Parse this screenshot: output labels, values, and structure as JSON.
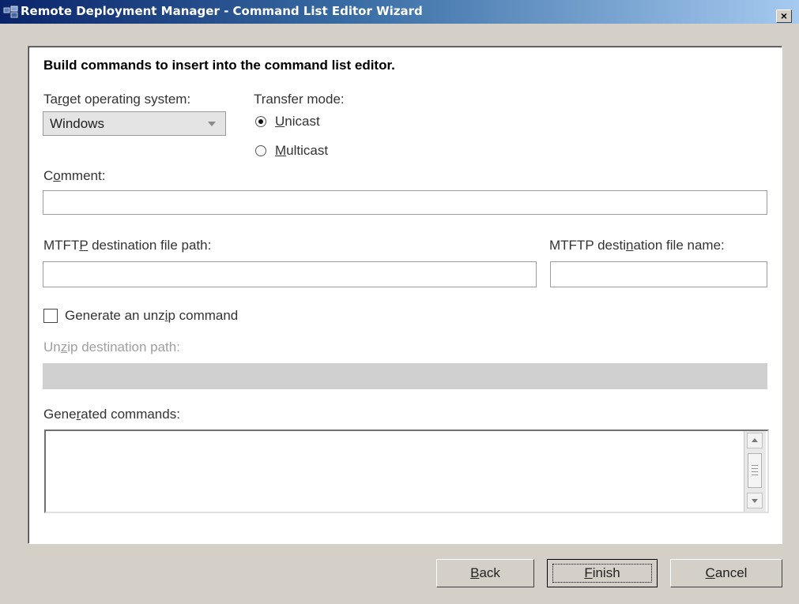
{
  "window": {
    "title": "Remote Deployment Manager - Command List Editor Wizard",
    "close_label": "×"
  },
  "panel": {
    "heading": "Build commands to insert into the command list editor."
  },
  "target_os": {
    "label_pre": "Ta",
    "label_mnemonic": "r",
    "label_post": "get operating system:",
    "value": "Windows"
  },
  "transfer_mode": {
    "label": "Transfer mode:",
    "options": [
      {
        "mnemonic": "U",
        "rest": "nicast",
        "selected": true
      },
      {
        "mnemonic": "M",
        "rest": "ulticast",
        "selected": false
      }
    ]
  },
  "comment": {
    "label_pre": "C",
    "label_mnemonic": "o",
    "label_post": "mment:",
    "value": ""
  },
  "mtftp_path": {
    "label_pre": "MTFT",
    "label_mnemonic": "P",
    "label_post": " destination file path:",
    "value": ""
  },
  "mtftp_name": {
    "label_pre": "MTFTP desti",
    "label_mnemonic": "n",
    "label_post": "ation file name:",
    "value": ""
  },
  "unzip_checkbox": {
    "label_pre": "Generate an unz",
    "label_mnemonic": "i",
    "label_post": "p command",
    "checked": false
  },
  "unzip_path": {
    "label_pre": "Un",
    "label_mnemonic": "z",
    "label_post": "ip destination path:",
    "value": ""
  },
  "generated": {
    "label_pre": "Gene",
    "label_mnemonic": "r",
    "label_post": "ated commands:",
    "value": ""
  },
  "buttons": {
    "back": {
      "mnemonic": "B",
      "rest": "ack"
    },
    "finish": {
      "mnemonic": "F",
      "rest": "inish"
    },
    "cancel": {
      "mnemonic": "C",
      "rest": "ancel"
    }
  }
}
